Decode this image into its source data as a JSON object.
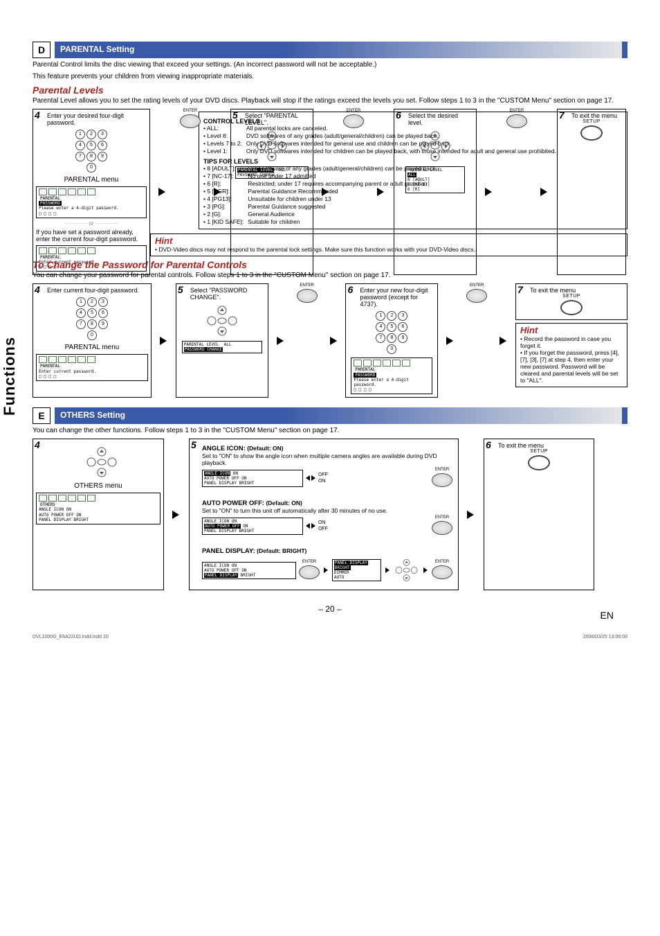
{
  "sidebar": {
    "label": "Functions"
  },
  "sectionD": {
    "letter": "D",
    "heading": "PARENTAL Setting",
    "intro1": "Parental Control limits the disc viewing that exceed your settings. (An incorrect password will not be acceptable.)",
    "intro2": "This feature prevents your children from viewing inappropriate materials.",
    "subheading1": "Parental Levels",
    "subdesc1": "Parental Level allows you to set the rating levels of your DVD discs. Playback will stop if the ratings exceed the levels you set. Follow steps 1 to 3 in the \"CUSTOM Menu\" section on page 17.",
    "step4": {
      "num": "4",
      "text": "Enter your desired four-digit password.",
      "menuLabel": "PARENTAL menu",
      "osdTitle": "PARENTAL",
      "osdSub": "PASSWORD",
      "osdPrompt": "Please enter a 4-digit password.",
      "osdBoxes": "□ □ □ □",
      "orLabel": "or",
      "altText": "If you have set a password already, enter the current four-digit password.",
      "osd2Prompt": "Enter current password.",
      "osd2Boxes": "□ □ □ □"
    },
    "enterLabel": "ENTER",
    "step5": {
      "num": "5",
      "text": "Select \"PARENTAL LEVEL\".",
      "osd_l1a": "PARENTAL LEVEL",
      "osd_l1b": "ALL",
      "osd_l2": "PASSWORD CHANGE"
    },
    "step6": {
      "num": "6",
      "text": "Select the desired level.",
      "osd_title": "PARENTAL LEVEL",
      "osd_opt1": "ALL",
      "osd_opt2": "8 [ADULT]",
      "osd_opt3": "7 [NC-17]",
      "osd_opt4": "6 [R]"
    },
    "step7": {
      "num": "7",
      "text": "To exit the menu",
      "setupLabel": "SETUP"
    },
    "ctrlBox": {
      "h1": "CONTROL LEVELS",
      "rows1": [
        [
          "• ALL:",
          "All parental locks are canceled."
        ],
        [
          "• Level 8:",
          "DVD softwares of any grades (adult/general/children) can be played back."
        ],
        [
          "• Levels 7 to 2:",
          "Only DVD softwares intended for general use and children can be played back."
        ],
        [
          "• Level 1:",
          "Only DVD softwares intended for children can be played back, with those intended for adult and general use prohibited."
        ]
      ],
      "h2": "TIPS FOR LEVELS",
      "rows2": [
        [
          "• 8 [ADULT]:",
          "DVD software of any grades (adult/general/children) can be played back."
        ],
        [
          "• 7 [NC-17]:",
          "No one under 17 admitted"
        ],
        [
          "• 6 [R]:",
          "Restricted; under 17 requires accompanying parent or adult guardian"
        ],
        [
          "• 5 [PGR]:",
          "Parental Guidance Recommended"
        ],
        [
          "• 4 [PG13]:",
          "Unsuitable for children under 13"
        ],
        [
          "• 3 [PG]:",
          "Parental Guidance suggested"
        ],
        [
          "• 2 [G]:",
          "General Audience"
        ],
        [
          "• 1 [KID SAFE]:",
          "Suitable for children"
        ]
      ]
    },
    "hint1": {
      "title": "Hint",
      "text": "• DVD-Video discs may not respond to the parental lock settings. Make sure this function works with your DVD-Video discs."
    },
    "subheading2": "To Change the Password for Parental Controls",
    "subdesc2": "You can change your password for parental controls. Follow steps 1 to 3 in the \"CUSTOM Menu\" section on page 17.",
    "pw_step4": {
      "num": "4",
      "text": "Enter current four-digit password.",
      "menuLabel": "PARENTAL menu",
      "osdTitle": "PARENTAL",
      "osdPrompt": "Enter current password.",
      "osdBoxes": "□ □ □ □"
    },
    "pw_step5": {
      "num": "5",
      "text": "Select \"PASSWORD CHANGE\".",
      "osd_l1a": "PARENTAL LEVEL",
      "osd_l1b": "ALL",
      "osd_l2": "PASSWORD CHANGE"
    },
    "pw_step6": {
      "num": "6",
      "text": "Enter your new four-digit password (except for 4737).",
      "osdTitle": "PARENTAL",
      "osdSub": "PASSWORD",
      "osdPrompt": "Please enter a 4-digit password.",
      "osdBoxes": "□ □ □ □"
    },
    "pw_step7": {
      "num": "7",
      "text": "To exit the menu",
      "setupLabel": "SETUP"
    },
    "hint2": {
      "title": "Hint",
      "b1": "• Record the password in case you forget it.",
      "b2": "• If you forget the password, press [4], [7], [3], [7] at step 4, then enter your new password. Password will be cleared and parental levels will be set to \"ALL\"."
    }
  },
  "sectionE": {
    "letter": "E",
    "heading": "OTHERS Setting",
    "intro": "You can change the other functions. Follow steps 1 to 3 in the \"CUSTOM Menu\" section on page 17.",
    "step4": {
      "num": "4",
      "menuLabel": "OTHERS menu",
      "osdTitle": "OTHERS",
      "osd_r1a": "ANGLE ICON",
      "osd_r1b": "ON",
      "osd_r2a": "AUTO POWER OFF",
      "osd_r2b": "ON",
      "osd_r3a": "PANEL DISPLAY",
      "osd_r3b": "BRIGHT"
    },
    "step5": {
      "num": "5",
      "angle": {
        "title": "ANGLE ICON:",
        "default": "(Default: ON)",
        "desc": "Set to \"ON\" to show the angle icon when multiple camera angles are available during DVD playback.",
        "osd_r1a": "ANGLE ICON",
        "osd_r1b": "ON",
        "opt1": "OFF",
        "opt2": "ON",
        "osd_r2a": "AUTO POWER OFF",
        "osd_r2b": "ON",
        "osd_r3a": "PANEL DISPLAY",
        "osd_r3b": "BRIGHT",
        "enter": "ENTER"
      },
      "auto": {
        "title": "AUTO POWER OFF:",
        "default": "(Default: ON)",
        "desc": "Set to \"ON\" to turn this unit off automatically after 30 minutes of no use.",
        "osd_r1a": "ANGLE ICON",
        "osd_r1b": "ON",
        "opt1": "ON",
        "opt2": "OFF",
        "osd_r2a": "AUTO POWER OFF",
        "osd_r2b": "ON",
        "osd_r3a": "PANEL DISPLAY",
        "osd_r3b": "BRIGHT",
        "enter": "ENTER"
      },
      "panel": {
        "title": "PANEL DISPLAY:",
        "default": "(Default: BRIGHT)",
        "osd_r1a": "ANGLE ICON",
        "osd_r1b": "ON",
        "osd_r2a": "AUTO POWER OFF",
        "osd_r2b": "ON",
        "osd_r3a": "PANEL DISPLAY",
        "osd_r3b": "BRIGHT",
        "pop_title": "PANEL DISPLAY",
        "pop_o1": "BRIGHT",
        "pop_o2": "DIMMER",
        "pop_o3": "AUTO",
        "enter": "ENTER"
      }
    },
    "step6": {
      "num": "6",
      "text": "To exit the menu",
      "setupLabel": "SETUP"
    }
  },
  "pageNum": "– 20 –",
  "lang": "EN",
  "footer": {
    "file": "DVL1000G_E6A22UD.indd.indd   20",
    "stamp": "2006/03/25   13:06:00"
  }
}
